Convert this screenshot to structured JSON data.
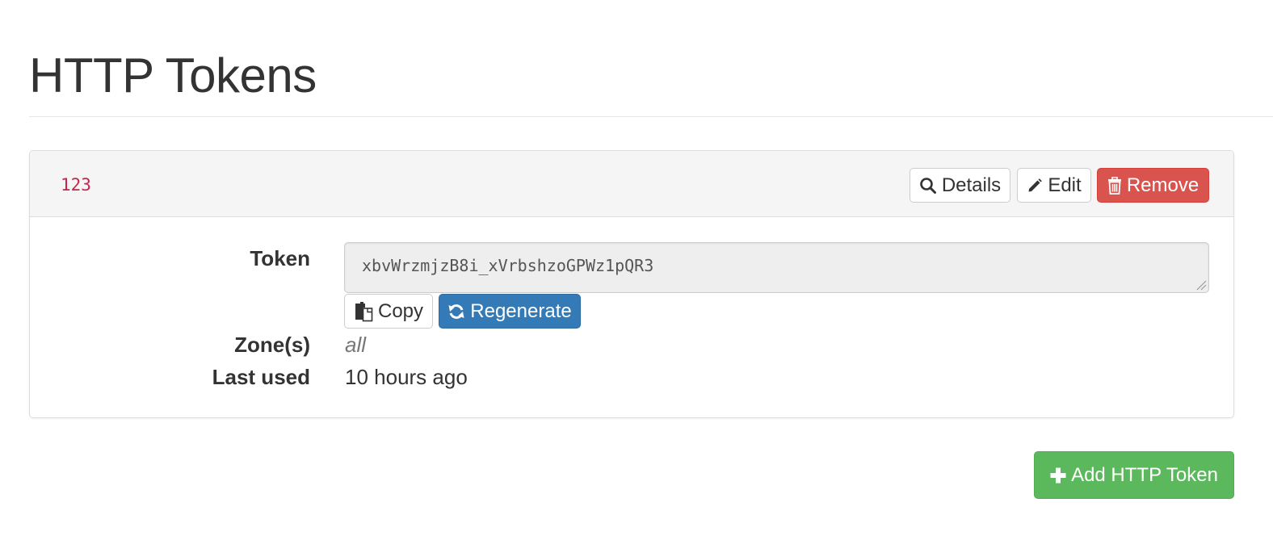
{
  "page": {
    "title": "HTTP Tokens"
  },
  "token_panel": {
    "name": "123",
    "buttons": {
      "details_label": "Details",
      "edit_label": "Edit",
      "remove_label": "Remove"
    },
    "fields": {
      "token_label": "Token",
      "token_value": "xbvWrzmjzB8i_xVrbshzoGPWz1pQR3",
      "copy_label": "Copy",
      "regenerate_label": "Regenerate",
      "zones_label": "Zone(s)",
      "zones_value": "all",
      "last_used_label": "Last used",
      "last_used_value": "10 hours ago"
    }
  },
  "actions": {
    "add_label": "Add HTTP Token"
  },
  "icons": {
    "details": "search-icon",
    "edit": "pencil-icon",
    "remove": "trash-icon",
    "copy": "copy-icon",
    "regenerate": "refresh-icon",
    "add": "plus-icon"
  },
  "colors": {
    "token_name": "#c7254e",
    "danger": "#d9534f",
    "primary": "#337ab7",
    "success": "#5cb85c"
  }
}
